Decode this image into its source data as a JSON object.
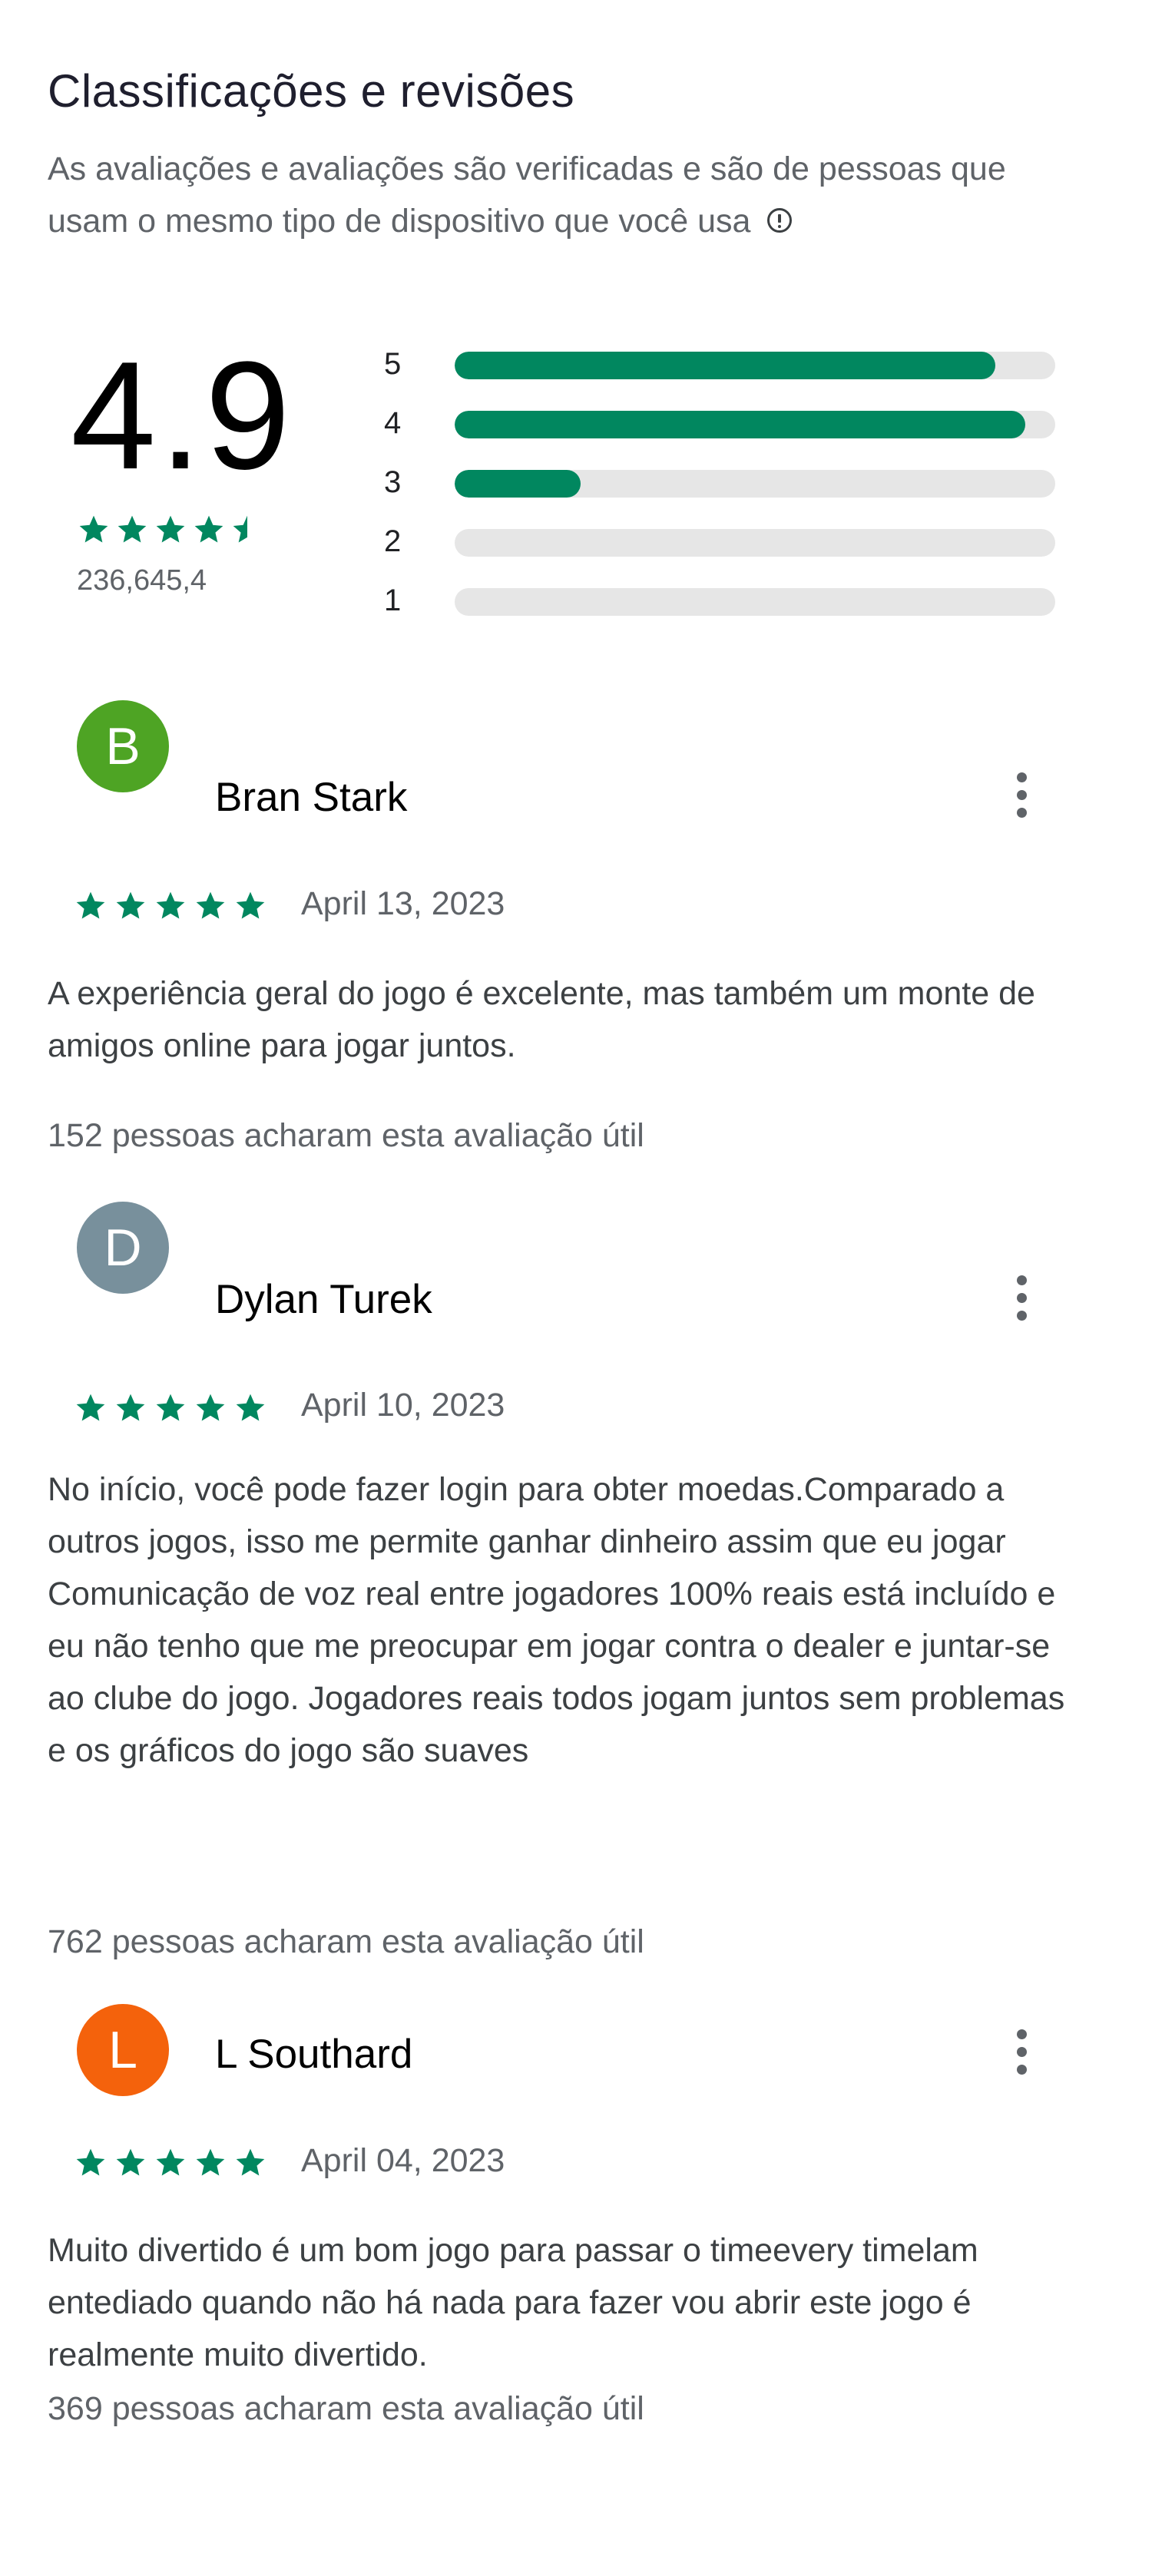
{
  "header": {
    "title": "Classificações e revisões",
    "subtitle": "As avaliações e avaliações são verificadas e são de pessoas que usam o mesmo tipo de dispositivo que você usa",
    "info_icon": "info-circle-icon"
  },
  "summary": {
    "score": "4.9",
    "stars": 4.5,
    "total_reviews": "236,645,4",
    "star_color": "#01875f",
    "distribution": [
      {
        "label": "5",
        "fraction": 0.9
      },
      {
        "label": "4",
        "fraction": 0.95
      },
      {
        "label": "3",
        "fraction": 0.21
      },
      {
        "label": "2",
        "fraction": 0.0
      },
      {
        "label": "1",
        "fraction": 0.0
      }
    ]
  },
  "reviews": [
    {
      "initial": "B",
      "name": "Bran Stark",
      "avatar_color": "#4ea424",
      "stars": 5,
      "date": "April 13, 2023",
      "text": "A experiência geral do jogo é excelente, mas também um monte de amigos online para jogar juntos.",
      "helpful": "152 pessoas acharam esta avaliação útil"
    },
    {
      "initial": "D",
      "name": "Dylan Turek",
      "avatar_color": "#78909c",
      "stars": 5,
      "date": "April 10, 2023",
      "text": "No início, você pode fazer login para obter moedas.Comparado a outros jogos, isso me permite ganhar dinheiro assim que eu jogar Comunicação de voz real entre jogadores 100% reais está incluído e eu não tenho que me preocupar em jogar contra o dealer e juntar-se ao clube do jogo. Jogadores reais todos jogam juntos sem problemas e os gráficos do jogo são suaves",
      "helpful": "762 pessoas acharam esta avaliação útil"
    },
    {
      "initial": "L",
      "name": "L Southard",
      "avatar_color": "#f4620c",
      "stars": 5,
      "date": "April 04, 2023",
      "text": "Muito divertido é um bom jogo para passar o timeevery timelam entediado quando não há nada para fazer vou abrir este jogo é realmente muito divertido.",
      "helpful": "369 pessoas acharam esta avaliação útil"
    }
  ]
}
